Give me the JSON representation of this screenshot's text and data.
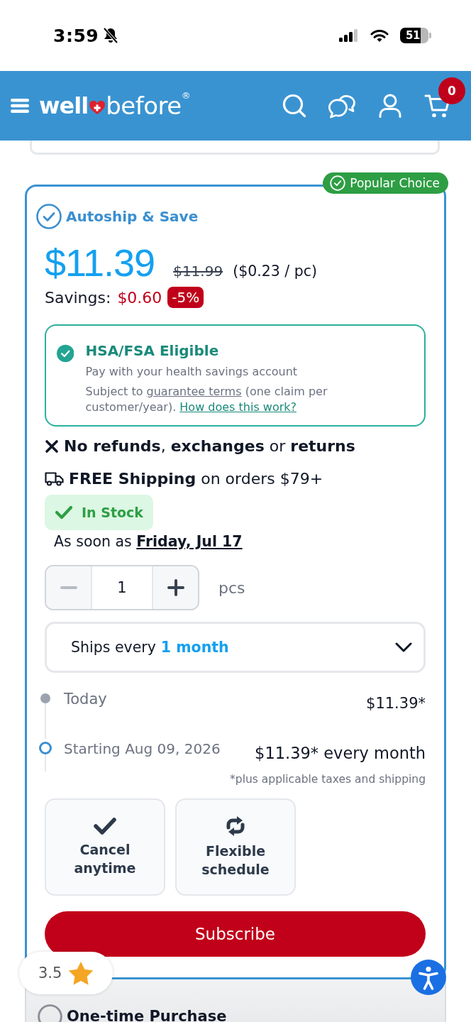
{
  "status_bar": {
    "time": "3:59",
    "battery": "51"
  },
  "header": {
    "logo": {
      "left": "well",
      "right": "before",
      "mark": "®"
    },
    "cart_count": "0"
  },
  "autoship": {
    "badge": "Popular Choice",
    "title": "Autoship & Save",
    "selected": true,
    "price": "$11.39",
    "original_price": "$11.99",
    "unit_price": "($0.23 / pc)",
    "savings_label": "Savings:",
    "savings_amount": "$0.60",
    "discount": "-5%",
    "hsa": {
      "title": "HSA/FSA Eligible",
      "description": "Pay with your health savings account",
      "terms_before": "Subject to",
      "terms_link": "guarantee terms",
      "terms_after": "(one claim per customer/year).",
      "help_link": "How does this work?"
    },
    "policy": "**No refunds**, **exchanges** or **returns**",
    "shipping": "**FREE Shipping** on orders $79+",
    "stock": "In Stock",
    "delivery": "As soon as **Friday, Jul 17**",
    "quantity": {
      "value": "1",
      "unit": "pcs",
      "decrease_disabled": true
    },
    "frequency": {
      "label": "Ships every",
      "value": "1 month"
    },
    "schedule": [
      {
        "kind": "current",
        "label": "Today",
        "price": "$11.39*"
      },
      {
        "kind": "upcoming",
        "label": "Starting Aug 09, 2026",
        "price": "$11.39* every month"
      }
    ],
    "footnote": "*plus applicable taxes and shipping",
    "benefits": [
      {
        "label": "Cancel anytime"
      },
      {
        "label": "Flexible schedule"
      }
    ],
    "button": "Subscribe"
  },
  "one_time": {
    "title": "One-time Purchase",
    "selected": false
  },
  "rating": {
    "value": "3.5"
  }
}
